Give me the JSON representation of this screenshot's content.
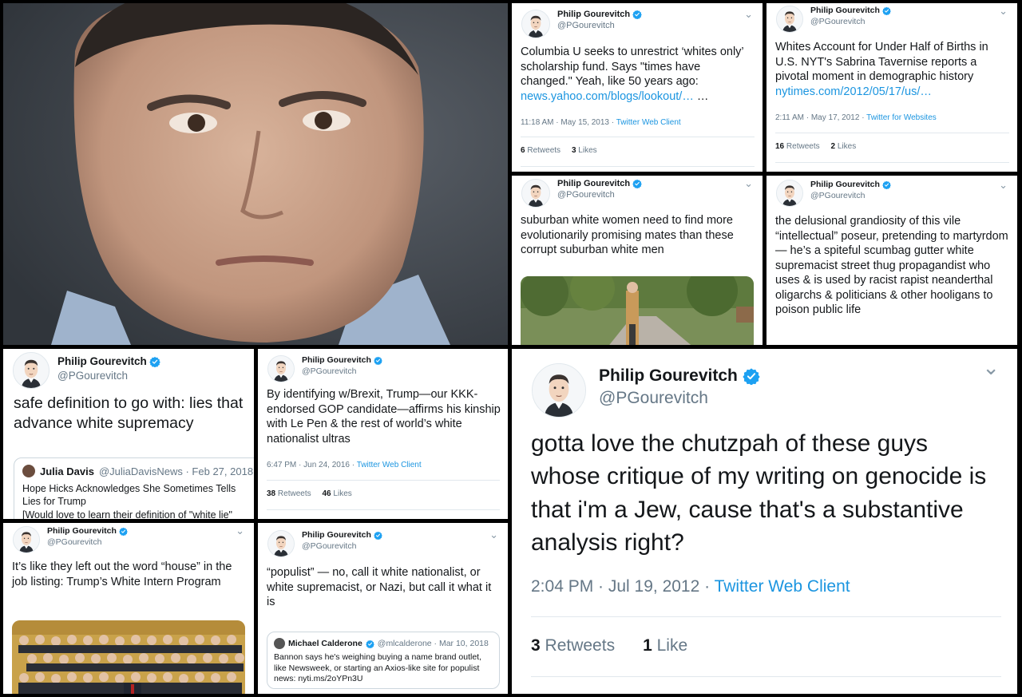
{
  "author": {
    "name": "Philip Gourevitch",
    "handle": "@PGourevitch"
  },
  "colors": {
    "link": "#1b95e0",
    "verified": "#1da1f2",
    "muted": "#657786"
  },
  "icons": {
    "verified": "verified-badge-icon",
    "chevron": "chevron-down-icon"
  },
  "chevron_glyph": "⌄",
  "tweets": {
    "columbia": {
      "text": "Columbia U seeks to unrestrict ‘whites only’ scholarship fund. Says \"times have changed.\" Yeah, like 50 years ago: ",
      "link": "news.yahoo.com/blogs/lookout/…",
      "text_after": " …",
      "time": "11:18 AM · May 15, 2013",
      "source": "Twitter Web Client",
      "retweets": "6",
      "retweets_label": "Retweets",
      "likes": "3",
      "likes_label": "Likes"
    },
    "births": {
      "text": "Whites Account for Under Half of Births in U.S. NYT's Sabrina Tavernise reports a pivotal moment in demographic history ",
      "link": "nytimes.com/2012/05/17/us/…",
      "time": "2:11 AM · May 17, 2012",
      "source": "Twitter for Websites",
      "retweets": "16",
      "retweets_label": "Retweets",
      "likes": "2",
      "likes_label": "Likes"
    },
    "suburban": {
      "text": "suburban white women need to find more evolutionarily promising mates than these corrupt suburban white men"
    },
    "grandiosity": {
      "text": "the delusional grandiosity of this vile “intellectual” poseur, pretending to martyrdom — he’s a spiteful scumbag gutter white supremacist street thug propagandist who uses & is used by racist rapist neanderthal oligarchs & politicians & other hooligans to poison public life"
    },
    "safe_definition": {
      "text": "safe definition to go with: lies that advance white supremacy",
      "quote": {
        "name": "Julia Davis",
        "handle": "@JuliaDavisNews · Feb 27, 2018",
        "line1": "Hope Hicks Acknowledges She Sometimes Tells",
        "line2": "Lies for Trump",
        "line3": "[Would love to learn their definition of \"white lie\""
      }
    },
    "brexit": {
      "text": "By identifying w/Brexit, Trump—our KKK-endorsed GOP candidate—affirms his kinship with Le Pen & the rest of world’s white nationalist ultras",
      "time": "6:47 PM · Jun 24, 2016",
      "source": "Twitter Web Client",
      "retweets": "38",
      "retweets_label": "Retweets",
      "likes": "46",
      "likes_label": "Likes"
    },
    "intern": {
      "text": "It’s like they left out the word “house” in the job listing: Trump’s White Intern Program"
    },
    "populist": {
      "text": "“populist” — no, call it white nationalist, or white supremacist, or Nazi, but call it what it is",
      "quote": {
        "name": "Michael Calderone",
        "handle": "@mlcalderone · Mar 10, 2018",
        "body": "Bannon says he's weighing buying a name brand outlet, like Newsweek, or starting an Axios-like site for populist news: nyti.ms/2oYPn3U"
      }
    },
    "chutzpah": {
      "text": "gotta love the chutzpah of these guys whose critique of my writing on genocide is that i'm a Jew, cause that's a substantive analysis right?",
      "time": "2:04 PM · Jul 19, 2012",
      "source": "Twitter Web Client",
      "retweets": "3",
      "retweets_label": "Retweets",
      "likes": "1",
      "likes_label": "Like"
    }
  }
}
